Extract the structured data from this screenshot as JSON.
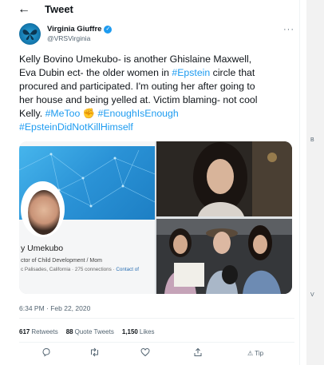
{
  "header": {
    "back_glyph": "←",
    "title": "Tweet"
  },
  "author": {
    "name": "Virginia Giuffre",
    "handle": "@VRSVirginia",
    "verified": true,
    "avatar_icon": "butterfly-icon"
  },
  "tweet": {
    "lines": [
      [
        {
          "t": "Kelly Bovino Umekubo- is another Ghislaine Maxwell,",
          "tag": false
        }
      ],
      [
        {
          "t": "Eva Dubin ect- the older women in ",
          "tag": false
        },
        {
          "t": "#Epstein",
          "tag": true
        },
        {
          "t": " circle that",
          "tag": false
        }
      ],
      [
        {
          "t": "procured and participated. I'm outing her after going to",
          "tag": false
        }
      ],
      [
        {
          "t": "her house and being yelled at. Victim blaming- not cool",
          "tag": false
        }
      ],
      [
        {
          "t": "Kelly. ",
          "tag": false
        },
        {
          "t": "#MeToo",
          "tag": true
        },
        {
          "t": " ",
          "tag": false
        },
        {
          "t": "#EnoughIsEnough",
          "tag": true
        }
      ],
      [
        {
          "t": "#EpsteinDidNotKillHimself",
          "tag": true
        }
      ]
    ],
    "metoo_emoji_icon": "raised-fist-icon"
  },
  "media": {
    "linkedin": {
      "name": "y Umekubo",
      "role": "ctor of Child Development / Mom",
      "location": "c Palisades, California · 275 connections · ",
      "contact": "Contact of"
    }
  },
  "timestamp": "6:34 PM · Feb 22, 2020",
  "stats": [
    {
      "count": "617",
      "label": "Retweets"
    },
    {
      "count": "88",
      "label": "Quote Tweets"
    },
    {
      "count": "1,150",
      "label": "Likes"
    }
  ],
  "actions": {
    "reply_icon": "reply-icon",
    "retweet_icon": "retweet-icon",
    "like_icon": "heart-icon",
    "share_icon": "share-icon",
    "tip_label": "Tip"
  },
  "more_glyph": "···",
  "right_panel": {
    "marks": [
      "B",
      "V"
    ]
  },
  "colors": {
    "link": "#1d9bf0",
    "text": "#0f1419",
    "muted": "#536471"
  }
}
